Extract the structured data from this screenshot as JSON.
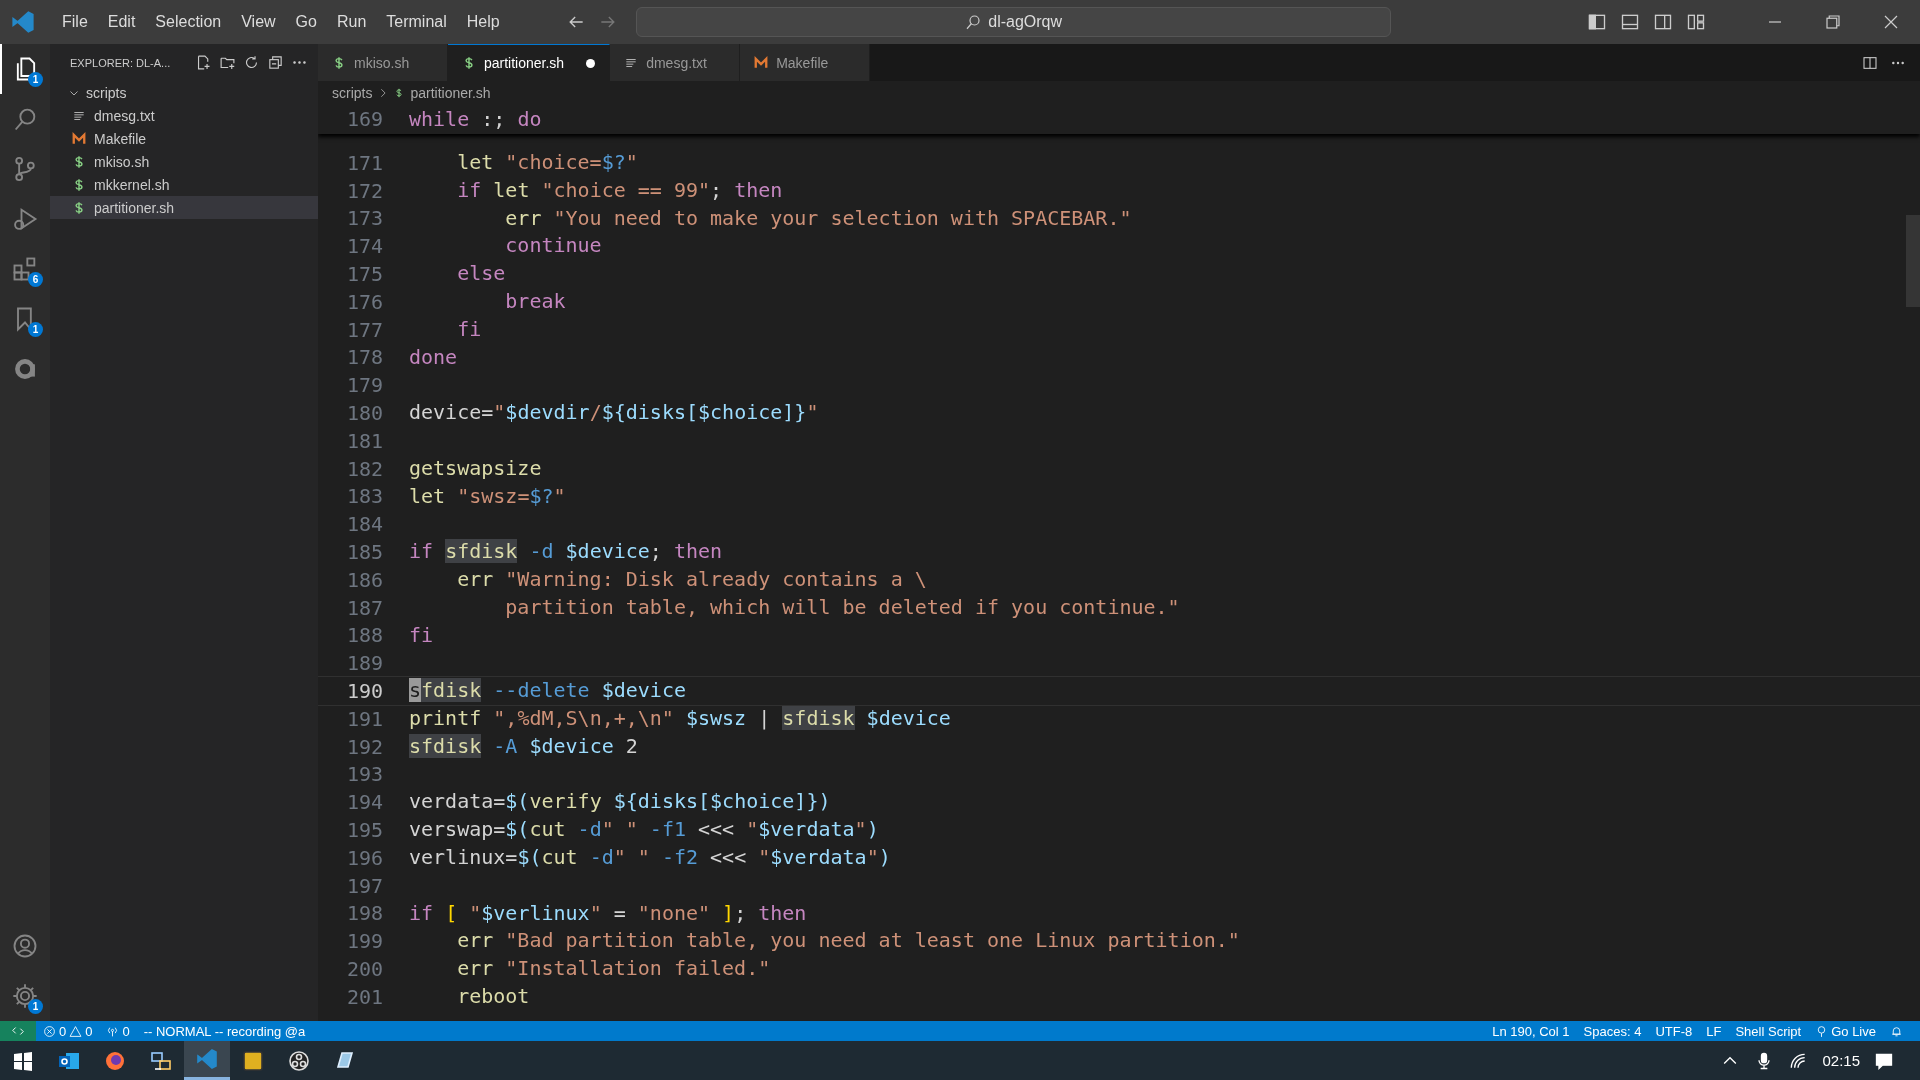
{
  "menu": [
    "File",
    "Edit",
    "Selection",
    "View",
    "Go",
    "Run",
    "Terminal",
    "Help"
  ],
  "command_center": {
    "text": "dl-agOrqw"
  },
  "activity_bar": {
    "top": [
      {
        "badge": "1",
        "selected": true
      },
      {
        "selected": false
      },
      {
        "selected": false
      },
      {
        "selected": false
      },
      {
        "badge": "6",
        "selected": false
      },
      {
        "badge": "1",
        "selected": false
      },
      {
        "selected": false
      }
    ],
    "bottom": [
      {
        "selected": false
      },
      {
        "badge": "1",
        "selected": false
      }
    ]
  },
  "sidebar": {
    "title": "EXPLORER: DL-A...",
    "tree": [
      {
        "label": "scripts",
        "expanded": true,
        "children": [
          {
            "label": "dmesg.txt",
            "kind": "txt",
            "selected": false
          },
          {
            "label": "Makefile",
            "kind": "make",
            "selected": false
          },
          {
            "label": "mkiso.sh",
            "kind": "shell",
            "selected": false
          },
          {
            "label": "mkkernel.sh",
            "kind": "shell",
            "selected": false
          },
          {
            "label": "partitioner.sh",
            "kind": "shell",
            "selected": true
          }
        ]
      }
    ]
  },
  "tabs": [
    {
      "label": "mkiso.sh",
      "kind": "shell",
      "selected": false,
      "dirty": false
    },
    {
      "label": "partitioner.sh",
      "kind": "shell",
      "selected": true,
      "dirty": true
    },
    {
      "label": "dmesg.txt",
      "kind": "txt",
      "selected": false,
      "dirty": false
    },
    {
      "label": "Makefile",
      "kind": "make",
      "selected": false,
      "dirty": false
    }
  ],
  "breadcrumb": [
    {
      "label": "scripts",
      "kind": "folder"
    },
    {
      "label": "partitioner.sh",
      "kind": "shell"
    }
  ],
  "sticky_line": {
    "number": "169",
    "tokens": [
      {
        "kind": "kw",
        "text": "while"
      },
      {
        "kind": "plain",
        "text": " :; "
      },
      {
        "kind": "kw",
        "text": "do"
      }
    ]
  },
  "code_lines": [
    {
      "number": "171",
      "selected": false,
      "tokens": [
        {
          "kind": "fn",
          "text": "    let "
        },
        {
          "kind": "str",
          "text": "\"choice="
        },
        {
          "kind": "const",
          "text": "$?"
        },
        {
          "kind": "str",
          "text": "\""
        }
      ]
    },
    {
      "number": "172",
      "selected": false,
      "tokens": [
        {
          "kind": "kw",
          "text": "    if "
        },
        {
          "kind": "fn",
          "text": "let "
        },
        {
          "kind": "str",
          "text": "\"choice == 99\""
        },
        {
          "kind": "plain",
          "text": "; "
        },
        {
          "kind": "kw",
          "text": "then"
        }
      ]
    },
    {
      "number": "173",
      "selected": false,
      "tokens": [
        {
          "kind": "fn",
          "text": "        err "
        },
        {
          "kind": "str",
          "text": "\"You need to make your selection with SPACEBAR.\""
        }
      ]
    },
    {
      "number": "174",
      "selected": false,
      "tokens": [
        {
          "kind": "kw",
          "text": "        continue"
        }
      ]
    },
    {
      "number": "175",
      "selected": false,
      "tokens": [
        {
          "kind": "kw",
          "text": "    else"
        }
      ]
    },
    {
      "number": "176",
      "selected": false,
      "tokens": [
        {
          "kind": "kw",
          "text": "        break"
        }
      ]
    },
    {
      "number": "177",
      "selected": false,
      "tokens": [
        {
          "kind": "kw",
          "text": "    fi"
        }
      ]
    },
    {
      "number": "178",
      "selected": false,
      "tokens": [
        {
          "kind": "kw",
          "text": "done"
        }
      ]
    },
    {
      "number": "179",
      "selected": false
    },
    {
      "number": "180",
      "selected": false,
      "tokens": [
        {
          "kind": "plain",
          "text": "device="
        },
        {
          "kind": "str",
          "text": "\""
        },
        {
          "kind": "var",
          "text": "$devdir"
        },
        {
          "kind": "str",
          "text": "/"
        },
        {
          "kind": "var",
          "text": "${disks[$choice]}"
        },
        {
          "kind": "str",
          "text": "\""
        }
      ]
    },
    {
      "number": "181",
      "selected": false
    },
    {
      "number": "182",
      "selected": false,
      "tokens": [
        {
          "kind": "fn",
          "text": "getswapsize"
        }
      ]
    },
    {
      "number": "183",
      "selected": false,
      "tokens": [
        {
          "kind": "fn",
          "text": "let "
        },
        {
          "kind": "str",
          "text": "\"swsz="
        },
        {
          "kind": "const",
          "text": "$?"
        },
        {
          "kind": "str",
          "text": "\""
        }
      ]
    },
    {
      "number": "184",
      "selected": false
    },
    {
      "number": "185",
      "selected": false,
      "tokens": [
        {
          "kind": "kw",
          "text": "if "
        },
        {
          "kind": "match",
          "text": "sfdisk"
        },
        {
          "kind": "const",
          "text": " -d "
        },
        {
          "kind": "var",
          "text": "$device"
        },
        {
          "kind": "plain",
          "text": "; "
        },
        {
          "kind": "kw",
          "text": "then"
        }
      ]
    },
    {
      "number": "186",
      "selected": false,
      "tokens": [
        {
          "kind": "fn",
          "text": "    err "
        },
        {
          "kind": "str",
          "text": "\"Warning: Disk already contains a \\"
        }
      ]
    },
    {
      "number": "187",
      "selected": false,
      "tokens": [
        {
          "kind": "str",
          "text": "        partition table, which will be deleted if you continue.\""
        }
      ]
    },
    {
      "number": "188",
      "selected": false,
      "tokens": [
        {
          "kind": "kw",
          "text": "fi"
        }
      ]
    },
    {
      "number": "189",
      "selected": false
    },
    {
      "number": "190",
      "selected": true,
      "tokens": [
        {
          "kind": "cursor",
          "text": "s"
        },
        {
          "kind": "match",
          "text": "fdisk"
        },
        {
          "kind": "const",
          "text": " --delete "
        },
        {
          "kind": "var",
          "text": "$device"
        }
      ]
    },
    {
      "number": "191",
      "selected": false,
      "tokens": [
        {
          "kind": "fn",
          "text": "printf "
        },
        {
          "kind": "str",
          "text": "\",%dM,S\\n,+,\\n\" "
        },
        {
          "kind": "var",
          "text": "$swsz"
        },
        {
          "kind": "plain",
          "text": " | "
        },
        {
          "kind": "match",
          "text": "sfdisk"
        },
        {
          "kind": "var",
          "text": " $device"
        }
      ]
    },
    {
      "number": "192",
      "selected": false,
      "tokens": [
        {
          "kind": "match",
          "text": "sfdisk"
        },
        {
          "kind": "const",
          "text": " -A "
        },
        {
          "kind": "var",
          "text": "$device"
        },
        {
          "kind": "plain",
          "text": " 2"
        }
      ]
    },
    {
      "number": "193",
      "selected": false
    },
    {
      "number": "194",
      "selected": false,
      "tokens": [
        {
          "kind": "plain",
          "text": "verdata="
        },
        {
          "kind": "var",
          "text": "$("
        },
        {
          "kind": "fn",
          "text": "verify "
        },
        {
          "kind": "var",
          "text": "${disks[$choice]})"
        }
      ]
    },
    {
      "number": "195",
      "selected": false,
      "tokens": [
        {
          "kind": "plain",
          "text": "verswap="
        },
        {
          "kind": "var",
          "text": "$("
        },
        {
          "kind": "fn",
          "text": "cut "
        },
        {
          "kind": "const",
          "text": "-d"
        },
        {
          "kind": "str",
          "text": "\" \" "
        },
        {
          "kind": "const",
          "text": "-f1"
        },
        {
          "kind": "plain",
          "text": " <<< "
        },
        {
          "kind": "str",
          "text": "\""
        },
        {
          "kind": "var",
          "text": "$verdata"
        },
        {
          "kind": "str",
          "text": "\""
        },
        {
          "kind": "var",
          "text": ")"
        }
      ]
    },
    {
      "number": "196",
      "selected": false,
      "tokens": [
        {
          "kind": "plain",
          "text": "verlinux="
        },
        {
          "kind": "var",
          "text": "$("
        },
        {
          "kind": "fn",
          "text": "cut "
        },
        {
          "kind": "const",
          "text": "-d"
        },
        {
          "kind": "str",
          "text": "\" \" "
        },
        {
          "kind": "const",
          "text": "-f2"
        },
        {
          "kind": "plain",
          "text": " <<< "
        },
        {
          "kind": "str",
          "text": "\""
        },
        {
          "kind": "var",
          "text": "$verdata"
        },
        {
          "kind": "str",
          "text": "\""
        },
        {
          "kind": "var",
          "text": ")"
        }
      ]
    },
    {
      "number": "197",
      "selected": false
    },
    {
      "number": "198",
      "selected": false,
      "tokens": [
        {
          "kind": "kw",
          "text": "if "
        },
        {
          "kind": "bracket",
          "text": "[ "
        },
        {
          "kind": "str",
          "text": "\""
        },
        {
          "kind": "var",
          "text": "$verlinux"
        },
        {
          "kind": "str",
          "text": "\""
        },
        {
          "kind": "plain",
          "text": " = "
        },
        {
          "kind": "str",
          "text": "\"none\" "
        },
        {
          "kind": "bracket",
          "text": "]"
        },
        {
          "kind": "plain",
          "text": "; "
        },
        {
          "kind": "kw",
          "text": "then"
        }
      ]
    },
    {
      "number": "199",
      "selected": false,
      "tokens": [
        {
          "kind": "fn",
          "text": "    err "
        },
        {
          "kind": "str",
          "text": "\"Bad partition table, you need at least one Linux partition.\""
        }
      ]
    },
    {
      "number": "200",
      "selected": false,
      "tokens": [
        {
          "kind": "fn",
          "text": "    err "
        },
        {
          "kind": "str",
          "text": "\"Installation failed.\""
        }
      ]
    },
    {
      "number": "201",
      "selected": false,
      "tokens": [
        {
          "kind": "fn",
          "text": "    reboot"
        }
      ]
    }
  ],
  "status_bar": {
    "errors": "0",
    "warnings": "0",
    "ports": "0",
    "mode": "-- NORMAL -- recording @a",
    "right": [
      {
        "kind": "text",
        "text": "Ln 190, Col 1"
      },
      {
        "kind": "text",
        "text": "Spaces: 4"
      },
      {
        "kind": "text",
        "text": "UTF-8"
      },
      {
        "kind": "text",
        "text": "LF"
      },
      {
        "kind": "text",
        "text": "Shell Script"
      },
      {
        "kind": "live",
        "text": "Go Live"
      },
      {
        "kind": "bell"
      }
    ]
  },
  "taskbar": {
    "apps": [
      {
        "selected": false
      },
      {
        "selected": false
      },
      {
        "selected": false
      },
      {
        "selected": true
      },
      {
        "selected": false
      },
      {
        "selected": false
      },
      {
        "selected": false
      }
    ],
    "time": "02:15"
  }
}
